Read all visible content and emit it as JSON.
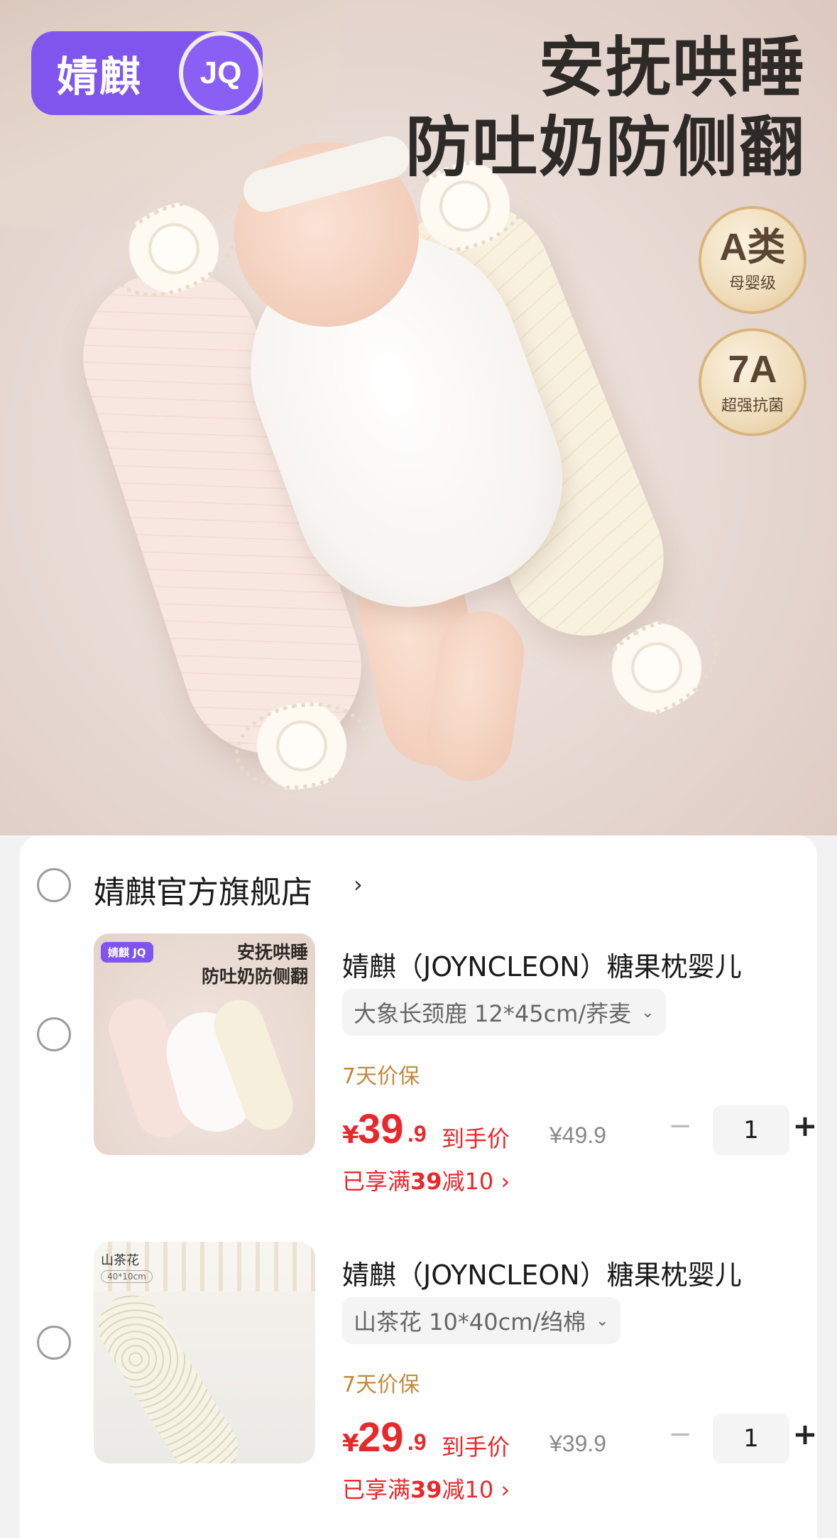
{
  "hero": {
    "brand_name": "婧麒",
    "brand_logo": "JQ",
    "headline_line1": "安抚哄睡",
    "headline_line2": "防吐奶防侧翻",
    "badges": [
      {
        "big": "A类",
        "small": "母婴级"
      },
      {
        "big": "7A",
        "small": "超强抗菌"
      }
    ]
  },
  "shop": {
    "name": "婧麒官方旗舰店",
    "chevron": "›"
  },
  "items": [
    {
      "title": "婧麒（JOYNCLEON）糖果枕婴儿",
      "variant": "大象长颈鹿 12*45cm/荞麦",
      "guarantee": "7天价保",
      "price_currency": "¥",
      "price_int": "39",
      "price_dec": ".9",
      "price_label": "到手价",
      "orig_price": "¥49.9",
      "discount_prefix": "已享满",
      "discount_amount": "39",
      "discount_suffix": "减10 ›",
      "qty": "1",
      "thumb": {
        "badge": "婧麒 JQ",
        "head1": "安抚哄睡",
        "head2": "防吐奶防侧翻"
      }
    },
    {
      "title": "婧麒（JOYNCLEON）糖果枕婴儿",
      "variant": "山茶花 10*40cm/绉棉",
      "guarantee": "7天价保",
      "price_currency": "¥",
      "price_int": "29",
      "price_dec": ".9",
      "price_label": "到手价",
      "orig_price": "¥39.9",
      "discount_prefix": "已享满",
      "discount_amount": "39",
      "discount_suffix": "减10 ›",
      "qty": "1",
      "thumb": {
        "label": "山茶花",
        "size": "40*10cm"
      }
    }
  ],
  "stepper": {
    "minus": "−",
    "plus": "+"
  },
  "colors": {
    "brand": "#7f55ee",
    "price": "#e8282b",
    "guarantee": "#c08a3e"
  }
}
